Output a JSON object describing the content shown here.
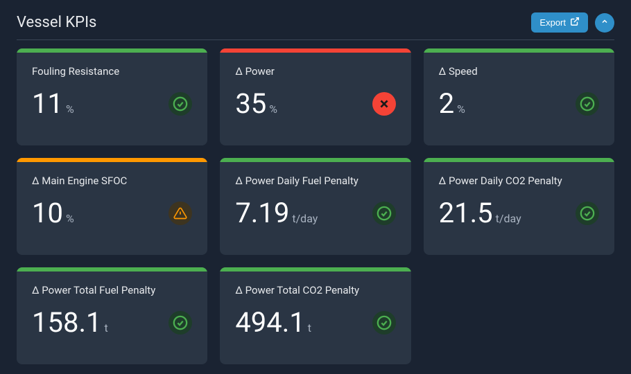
{
  "header": {
    "title": "Vessel KPIs",
    "export_label": "Export"
  },
  "colors": {
    "green": "#4caf50",
    "red": "#f44336",
    "orange": "#ff9800"
  },
  "cards": [
    {
      "label": "Fouling Resistance",
      "value": "11",
      "unit": "%",
      "status": "ok",
      "bar": "green"
    },
    {
      "label": "Δ Power",
      "value": "35",
      "unit": "%",
      "status": "error",
      "bar": "red"
    },
    {
      "label": "Δ Speed",
      "value": "2",
      "unit": "%",
      "status": "ok",
      "bar": "green"
    },
    {
      "label": "Δ Main Engine SFOC",
      "value": "10",
      "unit": "%",
      "status": "warn",
      "bar": "orange"
    },
    {
      "label": "Δ Power Daily Fuel Penalty",
      "value": "7.19",
      "unit": "t/day",
      "status": "ok",
      "bar": "green"
    },
    {
      "label": "Δ Power Daily CO2 Penalty",
      "value": "21.5",
      "unit": "t/day",
      "status": "ok",
      "bar": "green"
    },
    {
      "label": "Δ Power Total Fuel Penalty",
      "value": "158.1",
      "unit": "t",
      "status": "ok",
      "bar": "green"
    },
    {
      "label": "Δ Power Total CO2 Penalty",
      "value": "494.1",
      "unit": "t",
      "status": "ok",
      "bar": "green"
    }
  ]
}
